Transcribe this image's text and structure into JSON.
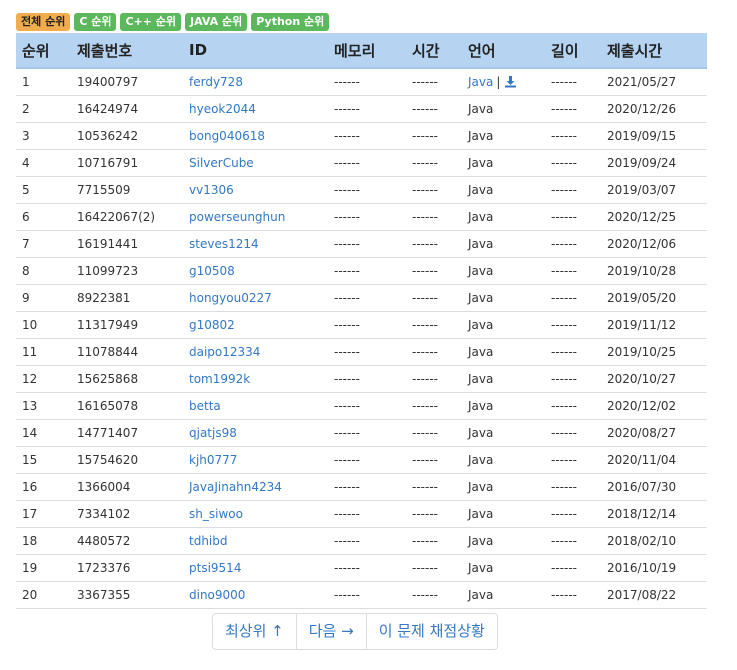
{
  "filters": [
    {
      "label": "전체 순위",
      "active": true
    },
    {
      "label": "C 순위",
      "active": false
    },
    {
      "label": "C++ 순위",
      "active": false
    },
    {
      "label": "JAVA 순위",
      "active": false
    },
    {
      "label": "Python 순위",
      "active": false
    }
  ],
  "columns": [
    "순위",
    "제출번호",
    "ID",
    "메모리",
    "시간",
    "언어",
    "길이",
    "제출시간"
  ],
  "rows": [
    {
      "rank": "1",
      "submission": "19400797",
      "resubmit": "",
      "user": "ferdy728",
      "memory": "------",
      "time": "------",
      "language": "Java",
      "has_download": true,
      "length": "------",
      "submitted": "2021/05/27"
    },
    {
      "rank": "2",
      "submission": "16424974",
      "resubmit": "",
      "user": "hyeok2044",
      "memory": "------",
      "time": "------",
      "language": "Java",
      "has_download": false,
      "length": "------",
      "submitted": "2020/12/26"
    },
    {
      "rank": "3",
      "submission": "10536242",
      "resubmit": "",
      "user": "bong040618",
      "memory": "------",
      "time": "------",
      "language": "Java",
      "has_download": false,
      "length": "------",
      "submitted": "2019/09/15"
    },
    {
      "rank": "4",
      "submission": "10716791",
      "resubmit": "",
      "user": "SilverCube",
      "memory": "------",
      "time": "------",
      "language": "Java",
      "has_download": false,
      "length": "------",
      "submitted": "2019/09/24"
    },
    {
      "rank": "5",
      "submission": "7715509",
      "resubmit": "",
      "user": "vv1306",
      "memory": "------",
      "time": "------",
      "language": "Java",
      "has_download": false,
      "length": "------",
      "submitted": "2019/03/07"
    },
    {
      "rank": "6",
      "submission": "16422067",
      "resubmit": "(2)",
      "user": "powerseunghun",
      "memory": "------",
      "time": "------",
      "language": "Java",
      "has_download": false,
      "length": "------",
      "submitted": "2020/12/25"
    },
    {
      "rank": "7",
      "submission": "16191441",
      "resubmit": "",
      "user": "steves1214",
      "memory": "------",
      "time": "------",
      "language": "Java",
      "has_download": false,
      "length": "------",
      "submitted": "2020/12/06"
    },
    {
      "rank": "8",
      "submission": "11099723",
      "resubmit": "",
      "user": "g10508",
      "memory": "------",
      "time": "------",
      "language": "Java",
      "has_download": false,
      "length": "------",
      "submitted": "2019/10/28"
    },
    {
      "rank": "9",
      "submission": "8922381",
      "resubmit": "",
      "user": "hongyou0227",
      "memory": "------",
      "time": "------",
      "language": "Java",
      "has_download": false,
      "length": "------",
      "submitted": "2019/05/20"
    },
    {
      "rank": "10",
      "submission": "11317949",
      "resubmit": "",
      "user": "g10802",
      "memory": "------",
      "time": "------",
      "language": "Java",
      "has_download": false,
      "length": "------",
      "submitted": "2019/11/12"
    },
    {
      "rank": "11",
      "submission": "11078844",
      "resubmit": "",
      "user": "daipo12334",
      "memory": "------",
      "time": "------",
      "language": "Java",
      "has_download": false,
      "length": "------",
      "submitted": "2019/10/25"
    },
    {
      "rank": "12",
      "submission": "15625868",
      "resubmit": "",
      "user": "tom1992k",
      "memory": "------",
      "time": "------",
      "language": "Java",
      "has_download": false,
      "length": "------",
      "submitted": "2020/10/27"
    },
    {
      "rank": "13",
      "submission": "16165078",
      "resubmit": "",
      "user": "betta",
      "memory": "------",
      "time": "------",
      "language": "Java",
      "has_download": false,
      "length": "------",
      "submitted": "2020/12/02"
    },
    {
      "rank": "14",
      "submission": "14771407",
      "resubmit": "",
      "user": "qjatjs98",
      "memory": "------",
      "time": "------",
      "language": "Java",
      "has_download": false,
      "length": "------",
      "submitted": "2020/08/27"
    },
    {
      "rank": "15",
      "submission": "15754620",
      "resubmit": "",
      "user": "kjh0777",
      "memory": "------",
      "time": "------",
      "language": "Java",
      "has_download": false,
      "length": "------",
      "submitted": "2020/11/04"
    },
    {
      "rank": "16",
      "submission": "1366004",
      "resubmit": "",
      "user": "JavaJinahn4234",
      "memory": "------",
      "time": "------",
      "language": "Java",
      "has_download": false,
      "length": "------",
      "submitted": "2016/07/30"
    },
    {
      "rank": "17",
      "submission": "7334102",
      "resubmit": "",
      "user": "sh_siwoo",
      "memory": "------",
      "time": "------",
      "language": "Java",
      "has_download": false,
      "length": "------",
      "submitted": "2018/12/14"
    },
    {
      "rank": "18",
      "submission": "4480572",
      "resubmit": "",
      "user": "tdhibd",
      "memory": "------",
      "time": "------",
      "language": "Java",
      "has_download": false,
      "length": "------",
      "submitted": "2018/02/10"
    },
    {
      "rank": "19",
      "submission": "1723376",
      "resubmit": "",
      "user": "ptsi9514",
      "memory": "------",
      "time": "------",
      "language": "Java",
      "has_download": false,
      "length": "------",
      "submitted": "2016/10/19"
    },
    {
      "rank": "20",
      "submission": "3367355",
      "resubmit": "",
      "user": "dino9000",
      "memory": "------",
      "time": "------",
      "language": "Java",
      "has_download": false,
      "length": "------",
      "submitted": "2017/08/22"
    }
  ],
  "download_separator": "|",
  "download_icon": "download-icon",
  "pager": {
    "top": "최상위 ↑",
    "next": "다음 →",
    "status": "이 문제 채점상황"
  },
  "colors": {
    "header_bg": "#b6d4f2",
    "link": "#3278c7",
    "badge_active": "#f0ad4e",
    "badge_normal": "#5cb85c"
  }
}
